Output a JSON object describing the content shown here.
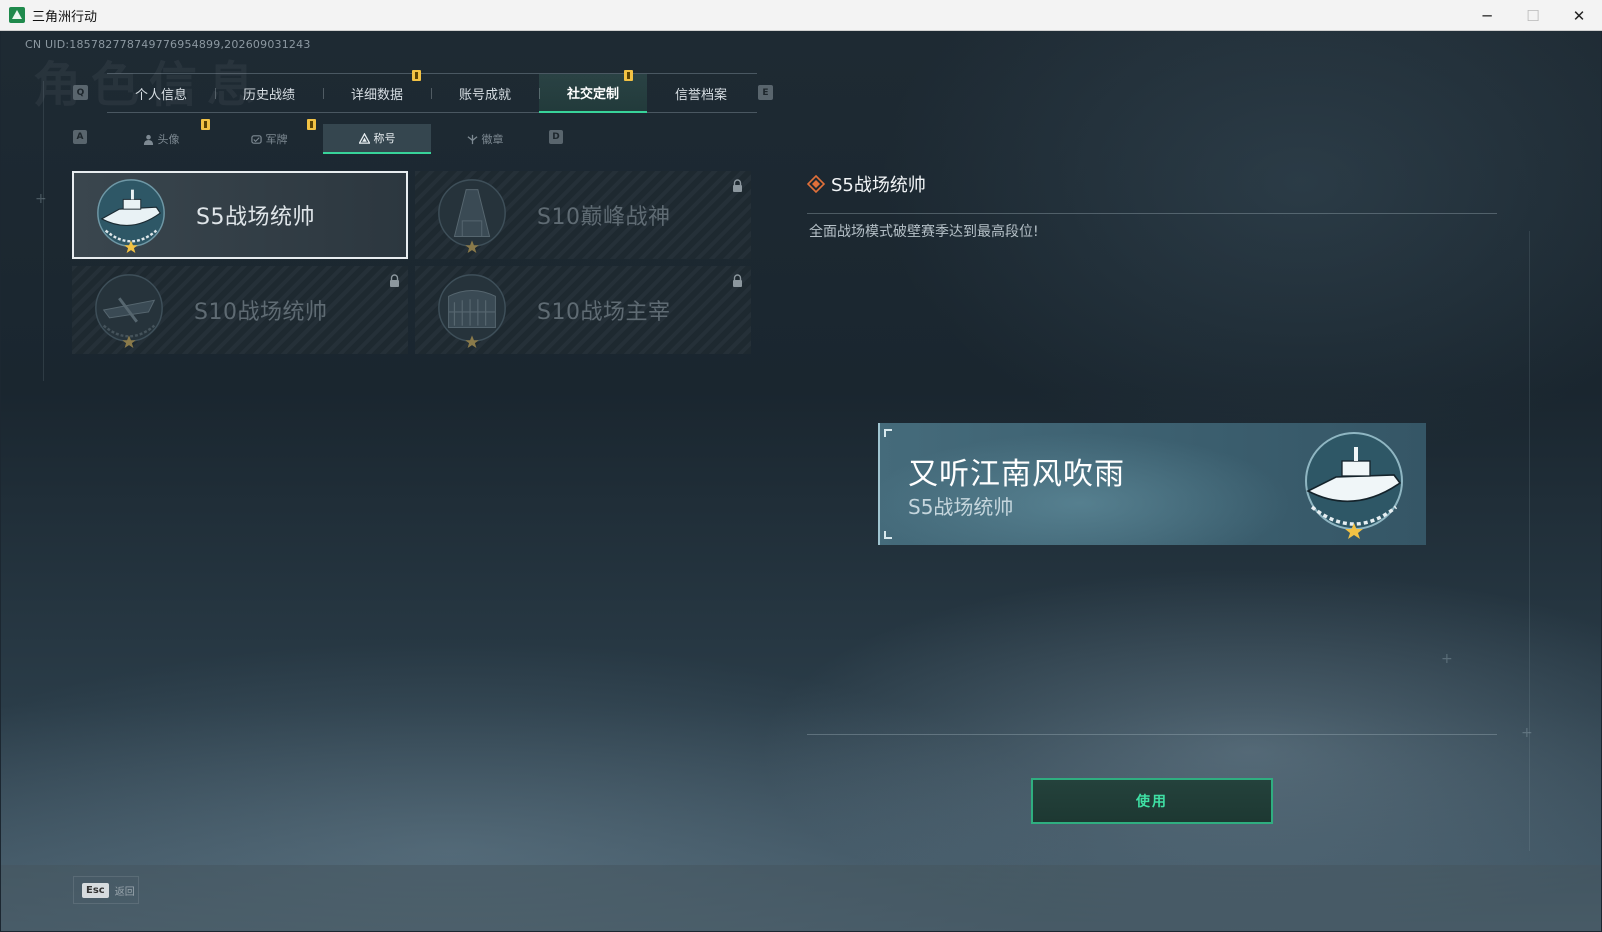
{
  "window": {
    "title": "三角洲行动",
    "minimize": "─",
    "maximize": "☐",
    "close": "✕"
  },
  "uid": "CN UID:185782778749776954899,202609031243",
  "watermark": "角色信息",
  "main_tabs": [
    {
      "label": "个人信息"
    },
    {
      "label": "历史战绩"
    },
    {
      "label": "详细数据"
    },
    {
      "label": "账号成就"
    },
    {
      "label": "社交定制"
    },
    {
      "label": "信誉档案"
    }
  ],
  "main_tabs_active": "社交定制",
  "key_hints": {
    "prev_main": "Q",
    "next_main": "E",
    "prev_sub": "A",
    "next_sub": "D"
  },
  "sub_tabs": [
    {
      "label": "头像"
    },
    {
      "label": "军牌"
    },
    {
      "label": "称号"
    },
    {
      "label": "徽章"
    }
  ],
  "sub_tabs_active": "称号",
  "cards": [
    {
      "name": "S5战场统帅",
      "locked": false,
      "selected": true
    },
    {
      "name": "S10巅峰战神",
      "locked": true,
      "selected": false
    },
    {
      "name": "S10战场统帅",
      "locked": true,
      "selected": false
    },
    {
      "name": "S10战场主宰",
      "locked": true,
      "selected": false
    }
  ],
  "detail": {
    "title": "S5战场统帅",
    "description": "全面战场模式破壁赛季达到最高段位!"
  },
  "banner": {
    "player_name": "又听江南风吹雨",
    "title": "S5战场统帅"
  },
  "use_button": "使用",
  "esc": {
    "key": "Esc",
    "label": "返回"
  },
  "colors": {
    "accent": "#38d39a",
    "notif": "#f2c244",
    "detail_icon": "#e0703a"
  }
}
